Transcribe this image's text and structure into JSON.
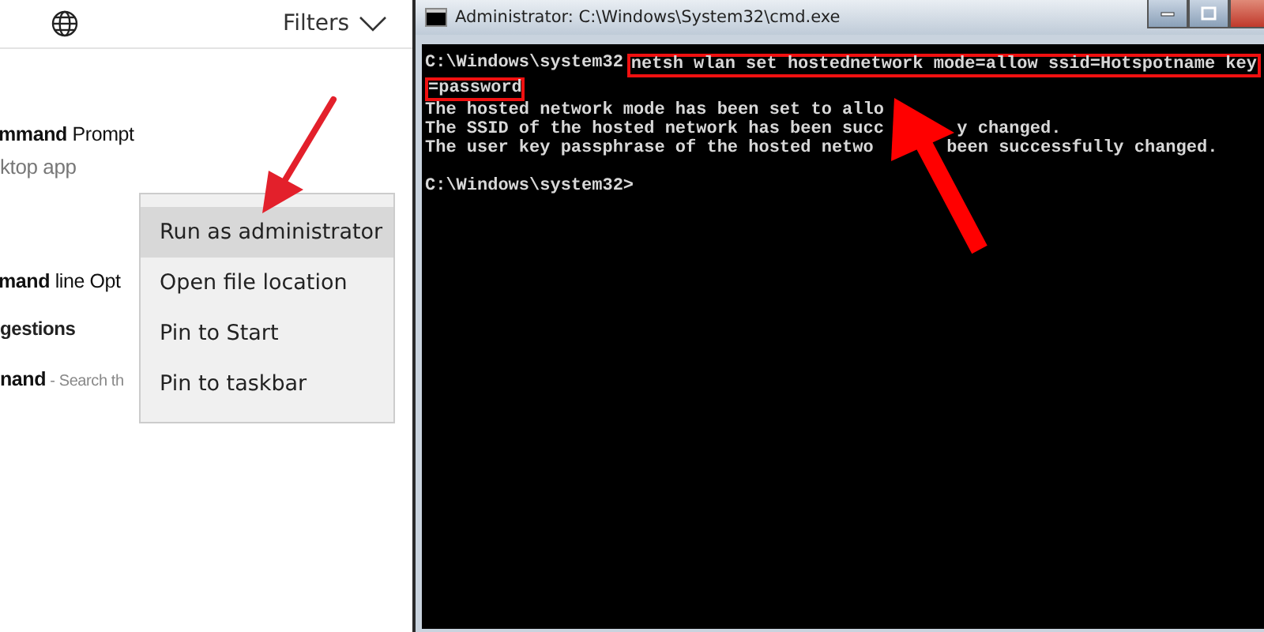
{
  "search_panel": {
    "filters_label": "Filters",
    "results": [
      {
        "kind": "title",
        "text": "**mmand** Prompt"
      },
      {
        "kind": "subtitle",
        "text": "ktop app"
      },
      {
        "kind": "title",
        "text": "**mand** line Opt"
      },
      {
        "kind": "heading",
        "text": "gestions"
      },
      {
        "kind": "suggestion",
        "text": "nand",
        "hint": " - Search th"
      }
    ],
    "context_menu": [
      {
        "label": "Run as administrator",
        "selected": true
      },
      {
        "label": "Open file location",
        "selected": false
      },
      {
        "label": "Pin to Start",
        "selected": false
      },
      {
        "label": "Pin to taskbar",
        "selected": false
      }
    ]
  },
  "console_window": {
    "title": "Administrator: C:\\Windows\\System32\\cmd.exe",
    "prompt": "C:\\Windows\\system32",
    "command": [
      "netsh wlan set hostednetwork mode=allow ssid=Hotspotname key",
      "=password"
    ],
    "output": [
      [
        "The hosted network mode has been set to allo"
      ],
      [
        "The SSID of the hosted network has been succ",
        "y changed."
      ],
      [
        "The user key passphrase of the hosted netwo",
        "been successfully changed."
      ]
    ],
    "final_prompt": "C:\\Windows\\system32>"
  }
}
